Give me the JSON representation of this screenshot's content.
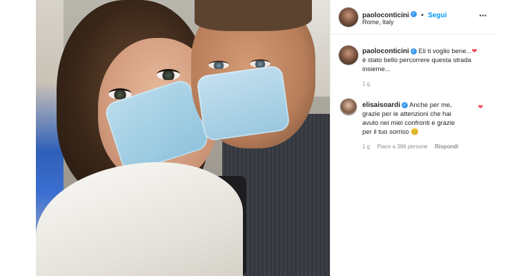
{
  "post": {
    "author": "paoloconticini",
    "follow_label": "Segui",
    "separator": "•",
    "location": "Rome, Italy",
    "more_icon": "more-horizontal-icon"
  },
  "caption": {
    "author": "paoloconticini",
    "line1": "Eli ti voglio bene...",
    "line2": "è stato bello percorrere questa strada",
    "line3": "insieme...",
    "heart": "❤",
    "time": "1 g"
  },
  "comment": {
    "author": "elisaisoardi",
    "line1": "Anche per me,",
    "line2": "grazie per le attenzioni che hai",
    "line3": "avuto nei miei confronti e grazie",
    "line4": "per il tuo sorriso",
    "emoji": "😊",
    "time": "1 g",
    "likes": "Piace a 386 persone",
    "reply": "Rispondi",
    "liked": true
  },
  "colors": {
    "accent": "#0095f6",
    "verified": "#3897f0",
    "heart": "#ed4956",
    "muted": "#8e8e8e"
  }
}
